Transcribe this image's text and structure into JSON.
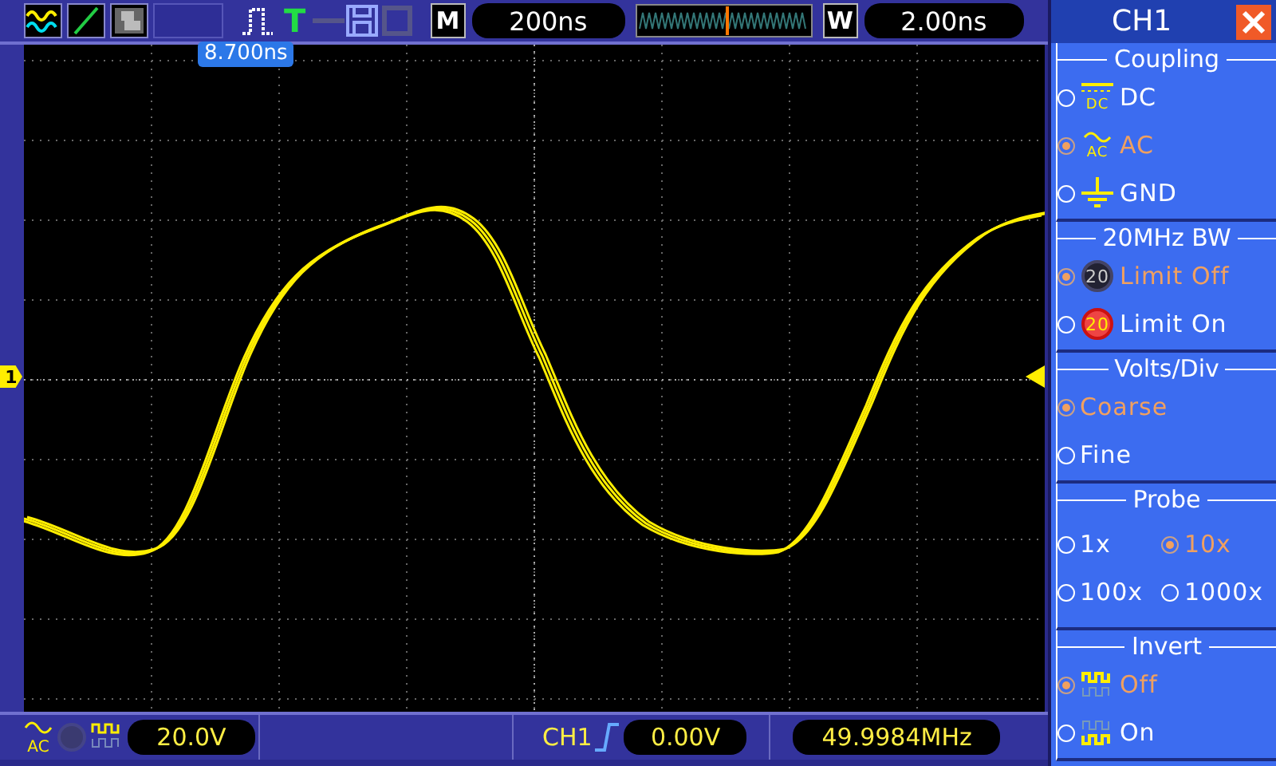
{
  "toolbar": {
    "trigger_letter": "T",
    "memory_label": "M",
    "timebase": "200ns",
    "window_label": "W",
    "window_time": "2.00ns"
  },
  "trigger_position": "8.700ns",
  "channel_marker": "1",
  "menu": {
    "title": "CH1",
    "sections": [
      {
        "title": "Coupling",
        "options": [
          {
            "label": "DC",
            "kind": "dc",
            "icon_label": "DC",
            "selected": false
          },
          {
            "label": "AC",
            "kind": "ac",
            "icon_label": "AC",
            "selected": true
          },
          {
            "label": "GND",
            "kind": "gnd",
            "selected": false
          }
        ]
      },
      {
        "title": "20MHz BW",
        "options": [
          {
            "label": "Limit Off",
            "kind": "bw-off",
            "icon_label": "20",
            "selected": true
          },
          {
            "label": "Limit On",
            "kind": "bw-on",
            "icon_label": "20",
            "selected": false
          }
        ]
      },
      {
        "title": "Volts/Div",
        "options": [
          {
            "label": "Coarse",
            "kind": "plain",
            "selected": true
          },
          {
            "label": "Fine",
            "kind": "plain",
            "selected": false
          }
        ]
      },
      {
        "title": "Probe",
        "options": [
          {
            "label": "1x",
            "kind": "plain",
            "selected": false
          },
          {
            "label": "10x",
            "kind": "plain",
            "selected": true
          },
          {
            "label": "100x",
            "kind": "plain",
            "selected": false
          },
          {
            "label": "1000x",
            "kind": "plain",
            "selected": false
          }
        ]
      },
      {
        "title": "Invert",
        "options": [
          {
            "label": "Off",
            "kind": "invert-off",
            "selected": true
          },
          {
            "label": "On",
            "kind": "invert-on",
            "selected": false
          }
        ]
      }
    ]
  },
  "status_bar": {
    "coupling_icon_label": "AC",
    "volts_per_div": "20.0V",
    "trigger_source": "CH1",
    "trigger_level": "0.00V",
    "frequency": "49.9984MHz"
  }
}
